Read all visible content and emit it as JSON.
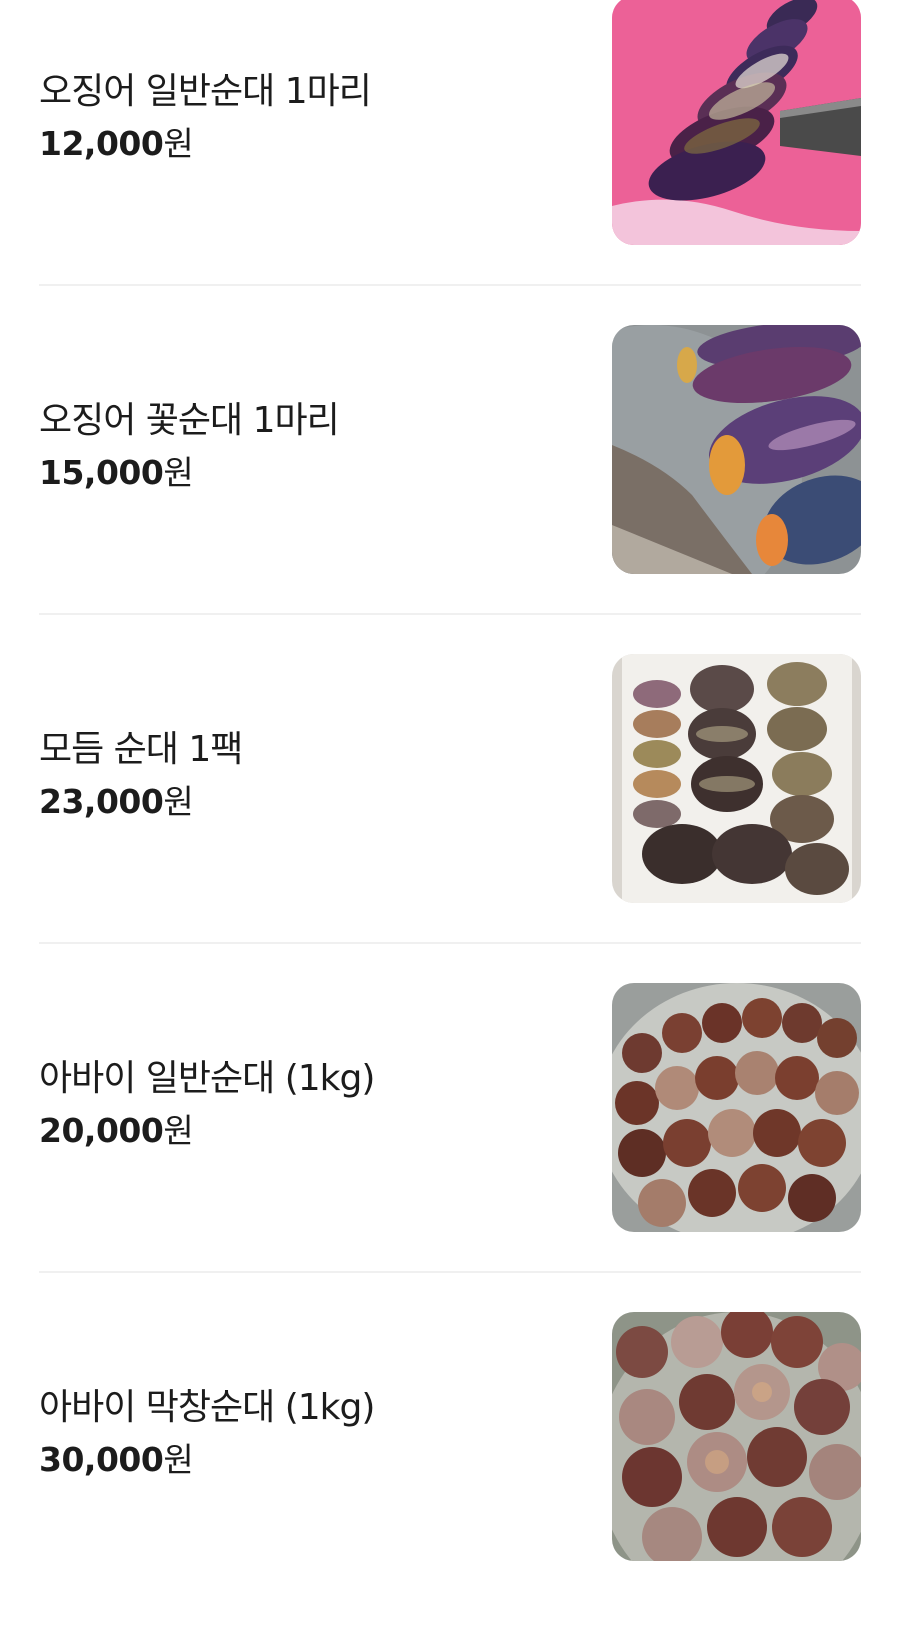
{
  "menu": {
    "items": [
      {
        "name": "오징어 일반순대 1마리",
        "price": "12,000",
        "currency": "원",
        "image_icon": "squid-sundae-sliced-photo"
      },
      {
        "name": "오징어 꽃순대 1마리",
        "price": "15,000",
        "currency": "원",
        "image_icon": "squid-flower-sundae-photo"
      },
      {
        "name": "모듬 순대 1팩",
        "price": "23,000",
        "currency": "원",
        "image_icon": "assorted-sundae-tray-photo"
      },
      {
        "name": "아바이 일반순대 (1kg)",
        "price": "20,000",
        "currency": "원",
        "image_icon": "abai-sundae-platter-photo"
      },
      {
        "name": "아바이 막창순대 (1kg)",
        "price": "30,000",
        "currency": "원",
        "image_icon": "abai-makchang-sundae-photo"
      }
    ]
  }
}
